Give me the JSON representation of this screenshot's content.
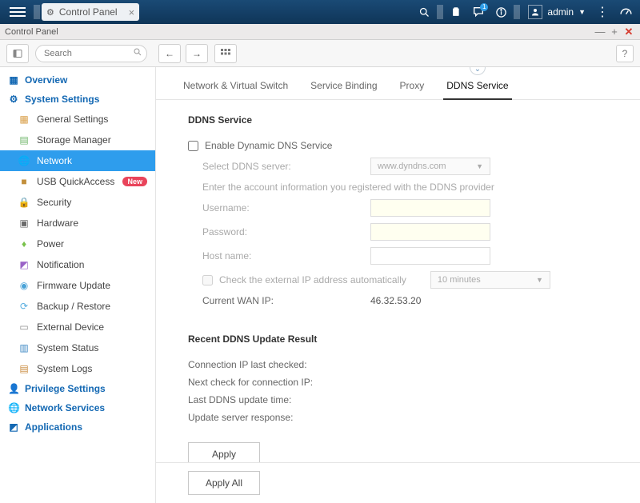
{
  "topbar": {
    "active_tab": "Control Panel",
    "notification_badge": "1",
    "user": "admin"
  },
  "window": {
    "title": "Control Panel"
  },
  "toolbar": {
    "search_placeholder": "Search"
  },
  "sidebar": {
    "categories": [
      {
        "icon": "grid",
        "label": "Overview"
      },
      {
        "icon": "gear",
        "label": "System Settings"
      }
    ],
    "items": [
      {
        "icon": "doc",
        "label": "General Settings"
      },
      {
        "icon": "drive",
        "label": "Storage Manager"
      },
      {
        "icon": "globe",
        "label": "Network",
        "active": true
      },
      {
        "icon": "usb",
        "label": "USB QuickAccess",
        "badge": "New"
      },
      {
        "icon": "lock",
        "label": "Security"
      },
      {
        "icon": "chip",
        "label": "Hardware"
      },
      {
        "icon": "bulb",
        "label": "Power"
      },
      {
        "icon": "bell",
        "label": "Notification"
      },
      {
        "icon": "fw",
        "label": "Firmware Update"
      },
      {
        "icon": "backup",
        "label": "Backup / Restore"
      },
      {
        "icon": "ext",
        "label": "External Device"
      },
      {
        "icon": "monitor",
        "label": "System Status"
      },
      {
        "icon": "log",
        "label": "System Logs"
      }
    ],
    "categories_after": [
      {
        "icon": "person",
        "label": "Privilege Settings"
      },
      {
        "icon": "net",
        "label": "Network Services"
      },
      {
        "icon": "apps",
        "label": "Applications"
      }
    ]
  },
  "tabs": [
    "Network & Virtual Switch",
    "Service Binding",
    "Proxy",
    "DDNS Service"
  ],
  "active_tab_index": 3,
  "ddns": {
    "title": "DDNS Service",
    "enable_label": "Enable Dynamic DNS Service",
    "select_server_label": "Select DDNS server:",
    "select_server_value": "www.dyndns.com",
    "account_info": "Enter the account information you registered with the DDNS provider",
    "username_label": "Username:",
    "password_label": "Password:",
    "hostname_label": "Host name:",
    "check_ip_label": "Check the external IP address automatically",
    "check_ip_interval": "10 minutes",
    "current_wan_label": "Current WAN IP:",
    "current_wan_value": "46.32.53.20"
  },
  "recent": {
    "title": "Recent DDNS Update Result",
    "rows": [
      "Connection IP last checked:",
      "Next check for connection IP:",
      "Last DDNS update time:",
      "Update server response:"
    ]
  },
  "buttons": {
    "apply": "Apply",
    "apply_all": "Apply All"
  }
}
